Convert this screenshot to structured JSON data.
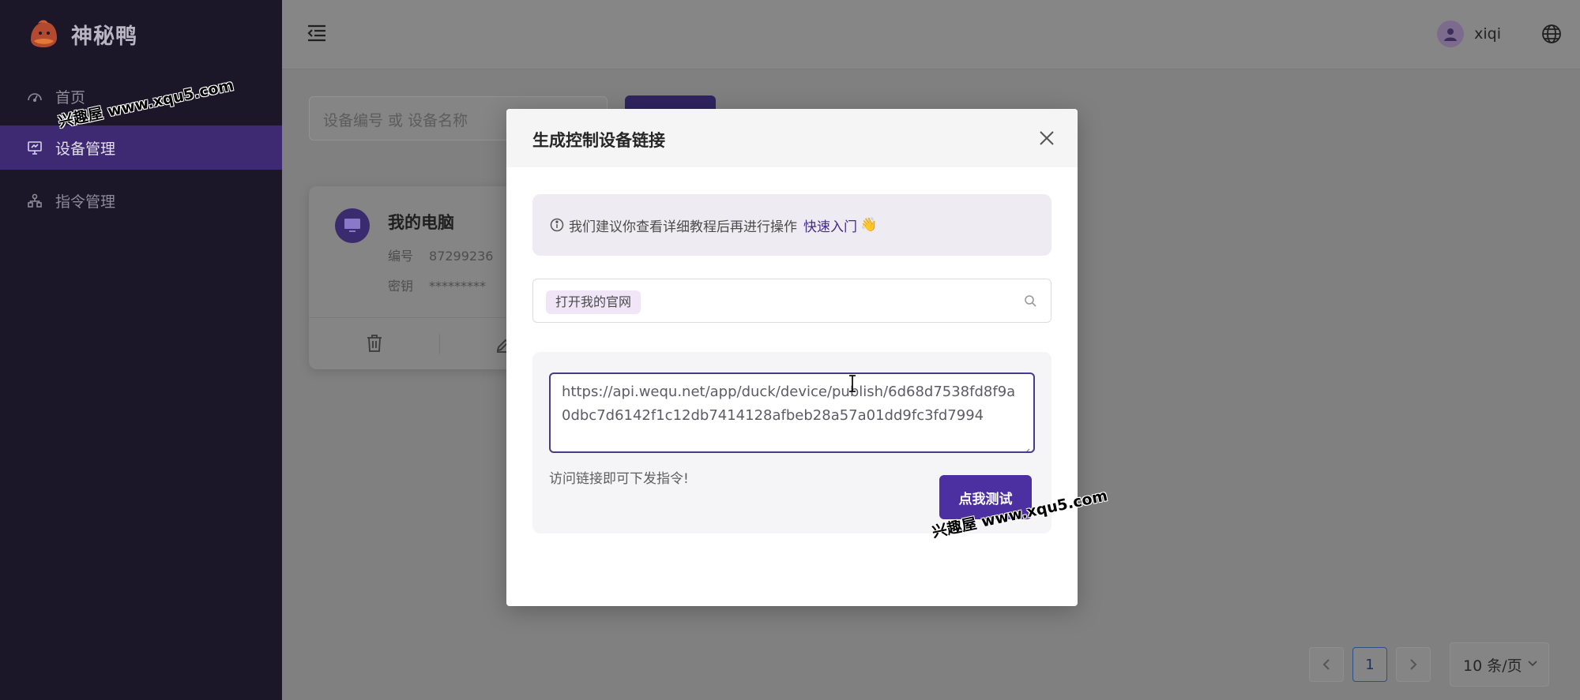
{
  "app": {
    "name": "神秘鸭"
  },
  "sidebar": {
    "items": [
      {
        "label": "首页",
        "icon": "dashboard-icon",
        "active": false
      },
      {
        "label": "设备管理",
        "icon": "monitor-icon",
        "active": true
      },
      {
        "label": "指令管理",
        "icon": "nodes-icon",
        "active": false
      }
    ]
  },
  "header": {
    "username": "xiqi"
  },
  "filters": {
    "search_placeholder": "设备编号 或 设备名称"
  },
  "device": {
    "name": "我的电脑",
    "id_label": "编号",
    "id_value": "87299236",
    "secret_label": "密钥",
    "secret_value": "*********"
  },
  "pagination": {
    "current": "1",
    "page_size": "10 条/页"
  },
  "modal": {
    "title": "生成控制设备链接",
    "tip_text": "我们建议你查看详细教程后再进行操作",
    "tip_link": "快速入门",
    "tip_emoji": "👋",
    "selected_command": "打开我的官网",
    "url": "https://api.wequ.net/app/duck/device/publish/6d68d7538fd8f9a0dbc7d6142f1c12db7414128afbeb28a57a01dd9fc3fd7994",
    "hint": "访问链接即可下发指令!",
    "test_button": "点我测试"
  },
  "watermark": {
    "text": "兴趣屋 www.xqu5.com"
  },
  "colors": {
    "sidebar_bg": "#1b1628",
    "active_nav": "#3e2a72",
    "primary": "#4c2fa0"
  }
}
